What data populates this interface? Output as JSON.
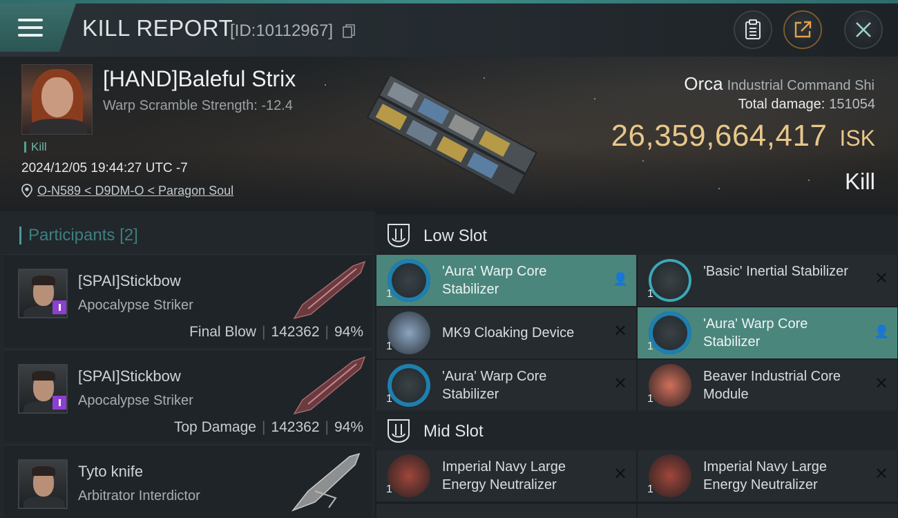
{
  "header": {
    "title": "KILL REPORT",
    "id_label": "[ID:10112967]",
    "icons": [
      "menu-icon",
      "copy-icon",
      "clipboard-icon",
      "share-icon",
      "close-icon"
    ]
  },
  "victim": {
    "name": "[HAND]Baleful Strix",
    "warp_scramble": "Warp Scramble Strength: -12.4",
    "kill_tag": "Kill",
    "time": "2024/12/05 19:44:27 UTC -7",
    "location": "O-N589 < D9DM-O < Paragon Soul",
    "ship_name": "Orca",
    "ship_class": "Industrial Command Shi",
    "total_damage_label": "Total damage:",
    "total_damage": "151054",
    "isk_value": "26,359,664,417",
    "isk_unit": "ISK",
    "result": "Kill"
  },
  "participants": {
    "label": "Participants",
    "count": "[2]",
    "items": [
      {
        "name": "[SPAI]Stickbow",
        "ship": "Apocalypse Striker",
        "role": "Final Blow",
        "damage": "142362",
        "percent": "94%"
      },
      {
        "name": "[SPAI]Stickbow",
        "ship": "Apocalypse Striker",
        "role": "Top Damage",
        "damage": "142362",
        "percent": "94%"
      },
      {
        "name": "Tyto knife",
        "ship": "Arbitrator Interdictor"
      }
    ]
  },
  "slots": {
    "low": {
      "title": "Low Slot",
      "modules": [
        {
          "name": "'Aura' Warp Core Stabilizer",
          "qty": "1",
          "state": "dropped"
        },
        {
          "name": "'Basic' Inertial Stabilizer",
          "qty": "1",
          "state": "destroyed"
        },
        {
          "name": "MK9 Cloaking Device",
          "qty": "1",
          "state": "destroyed"
        },
        {
          "name": "'Aura' Warp Core Stabilizer",
          "qty": "1",
          "state": "dropped"
        },
        {
          "name": "'Aura' Warp Core Stabilizer",
          "qty": "1",
          "state": "destroyed"
        },
        {
          "name": "Beaver Industrial Core Module",
          "qty": "1",
          "state": "destroyed"
        }
      ]
    },
    "mid": {
      "title": "Mid Slot",
      "modules": [
        {
          "name": "Imperial Navy Large Energy Neutralizer",
          "qty": "1",
          "state": "destroyed"
        },
        {
          "name": "Imperial Navy Large Energy Neutralizer",
          "qty": "1",
          "state": "destroyed"
        }
      ]
    }
  },
  "colors": {
    "accent": "#4b867d",
    "isk": "#e8c78a",
    "teal": "#3d7f82",
    "purple_badge": "#8c3fd0"
  }
}
